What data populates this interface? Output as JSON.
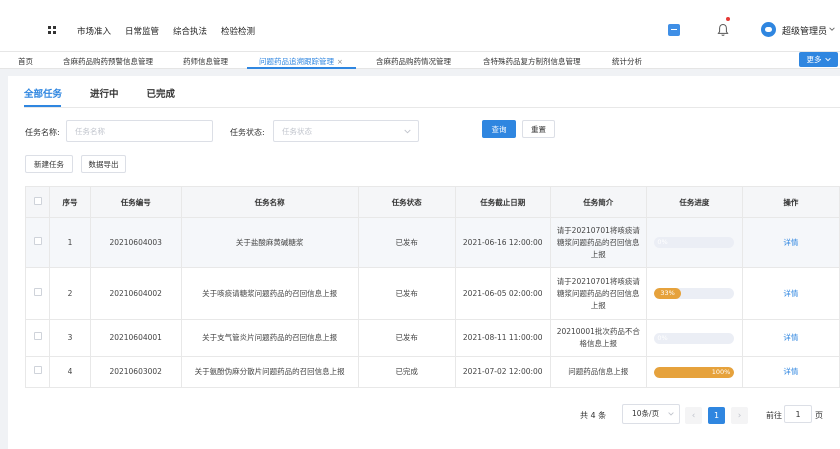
{
  "header": {
    "nav": [
      "市场准入",
      "日常监管",
      "综合执法",
      "检验检测"
    ],
    "username": "超级管理员"
  },
  "tabs": [
    {
      "label": "首页"
    },
    {
      "label": "含麻药品购药预警信息管理"
    },
    {
      "label": "药师信息管理"
    },
    {
      "label": "问题药品追溯跟踪管理",
      "active": true
    },
    {
      "label": "含麻药品购药情况管理"
    },
    {
      "label": "含特殊药品复方制剂信息管理"
    },
    {
      "label": "统计分析"
    }
  ],
  "more_label": "更多",
  "subtabs": [
    "全部任务",
    "进行中",
    "已完成"
  ],
  "filter": {
    "name_label": "任务名称:",
    "name_placeholder": "任务名称",
    "status_label": "任务状态:",
    "status_placeholder": "任务状态",
    "query": "查询",
    "reset": "重置"
  },
  "actions": {
    "create": "新建任务",
    "export": "数据导出"
  },
  "table": {
    "columns": [
      "序号",
      "任务编号",
      "任务名称",
      "任务状态",
      "任务截止日期",
      "任务简介",
      "任务进度",
      "操作"
    ],
    "rows": [
      {
        "seq": "1",
        "code": "20210604003",
        "name": "关于盐酸麻黄碱糖浆",
        "status": "已发布",
        "deadline": "2021-06-16 12:00:00",
        "intro": "请于20210701将咳痰请糖浆问题药品的召回信息上报",
        "progress": 0,
        "progress_text": "0%",
        "action": "详情"
      },
      {
        "seq": "2",
        "code": "20210604002",
        "name": "关于咳痰请糖浆问题药品的召回信息上报",
        "status": "已发布",
        "deadline": "2021-06-05 02:00:00",
        "intro": "请于20210701将咳痰请糖浆问题药品的召回信息上报",
        "progress": 33,
        "progress_text": "33%",
        "action": "详情"
      },
      {
        "seq": "3",
        "code": "20210604001",
        "name": "关于支气管炎片问题药品的召回信息上报",
        "status": "已发布",
        "deadline": "2021-08-11 11:00:00",
        "intro": "20210001批次药品不合格信息上报",
        "progress": 0,
        "progress_text": "0%",
        "action": "详情"
      },
      {
        "seq": "4",
        "code": "20210603002",
        "name": "关于氨酚伪麻分散片问题药品的召回信息上报",
        "status": "已完成",
        "deadline": "2021-07-02 12:00:00",
        "intro": "问题药品信息上报",
        "progress": 100,
        "progress_text": "100%",
        "action": "详情"
      }
    ]
  },
  "pagination": {
    "total": "共 4 条",
    "page_size": "10条/页",
    "prev": "‹",
    "next": "›",
    "current": "1",
    "goto_label": "前往",
    "goto_value": "1",
    "page_suffix": "页"
  },
  "colors": {
    "primary": "#2f86e0",
    "progress": "#e6a23c",
    "badge": "#e53935"
  },
  "icons": [
    "grid-icon",
    "window-icon",
    "bell-icon",
    "avatar-icon",
    "chevron-down-icon",
    "close-icon",
    "checkbox-icon"
  ]
}
